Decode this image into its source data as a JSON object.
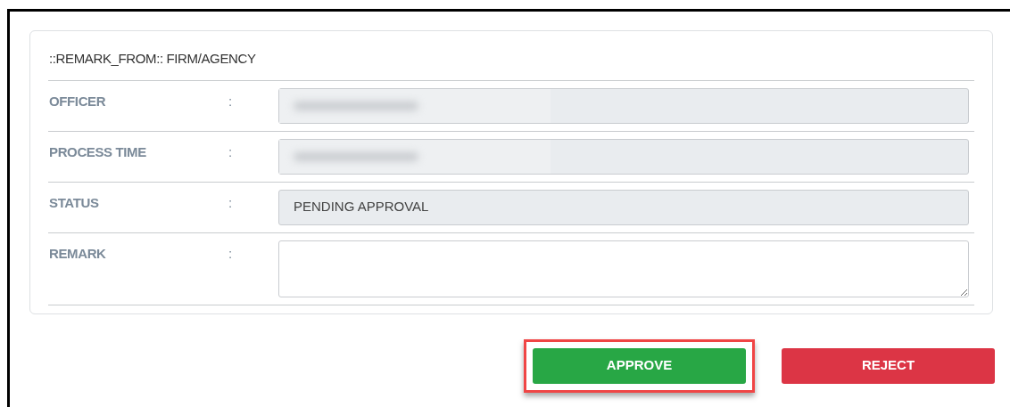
{
  "panel": {
    "title": "::REMARK_FROM:: FIRM/AGENCY",
    "rows": [
      {
        "label": "OFFICER",
        "separator": ":",
        "kind": "input",
        "redacted": true
      },
      {
        "label": "PROCESS TIME",
        "separator": ":",
        "kind": "input",
        "redacted": true
      },
      {
        "label": "STATUS",
        "separator": ":",
        "kind": "input",
        "value": "PENDING APPROVAL",
        "redacted": false
      },
      {
        "label": "REMARK",
        "separator": ":",
        "kind": "textarea"
      }
    ]
  },
  "buttons": [
    {
      "label": "APPROVE",
      "kind": "approve",
      "highlighted": true
    },
    {
      "label": "REJECT",
      "kind": "reject",
      "highlighted": false
    }
  ]
}
